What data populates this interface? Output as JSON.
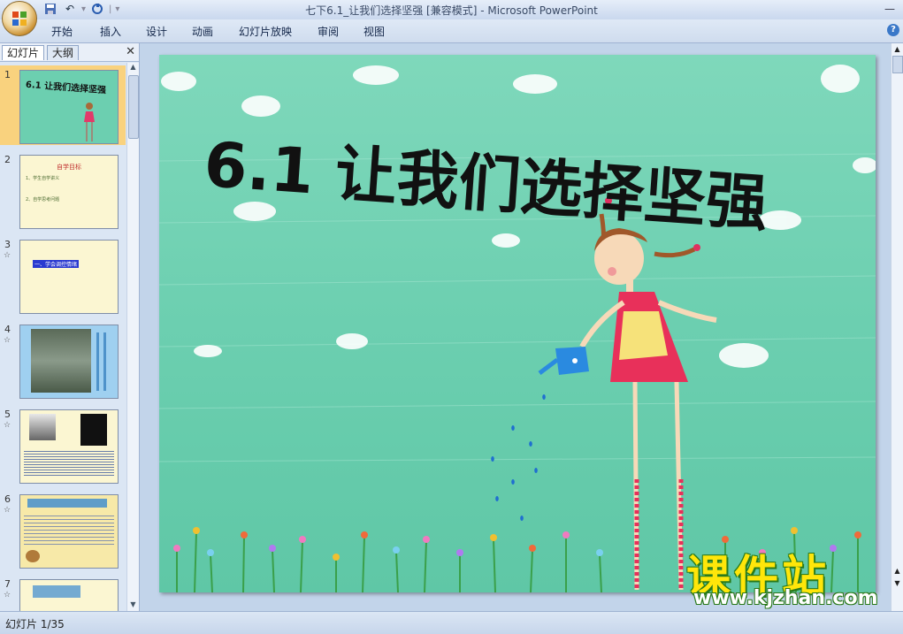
{
  "app": {
    "window_title": "七下6.1_让我们选择坚强 [兼容模式] - Microsoft PowerPoint"
  },
  "ribbon": {
    "tabs": [
      "开始",
      "插入",
      "设计",
      "动画",
      "幻灯片放映",
      "审阅",
      "视图"
    ]
  },
  "left_pane": {
    "tabs": [
      "幻灯片",
      "大纲"
    ],
    "slides": [
      {
        "num": "1",
        "title": "6.1 让我们选择坚强"
      },
      {
        "num": "2",
        "title": "自学目标",
        "lines": [
          "1、学生自学讲义",
          "2、自学思考问题"
        ]
      },
      {
        "num": "3",
        "title": "一、学会调控情绪"
      },
      {
        "num": "4"
      },
      {
        "num": "5"
      },
      {
        "num": "6"
      },
      {
        "num": "7"
      }
    ]
  },
  "slide": {
    "title": "6.1 让我们选择坚强"
  },
  "watermark": {
    "cn": "课件站",
    "url": "www.kjzhan.com"
  },
  "status": {
    "text": "幻灯片 1/35"
  },
  "colors": {
    "slide_bg": "#6ccfb0",
    "selected_thumb": "#f9d27e",
    "ribbon": "#dfe9f6"
  }
}
